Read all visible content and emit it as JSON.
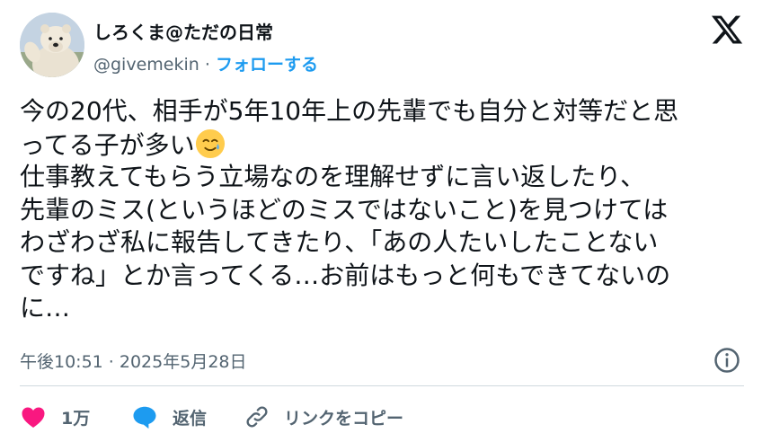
{
  "user": {
    "display_name": "しろくま@ただの日常",
    "handle": "@givemekin",
    "separator": "·",
    "follow_label": "フォローする"
  },
  "tweet": {
    "lines": [
      "今の20代、相手が5年10年上の先輩でも自分と対等だと思",
      "ってる子が多い",
      "仕事教えてもらう立場なのを理解せずに言い返したり、",
      "先輩のミス(というほどのミスではないこと)を見つけては",
      "わざわざ私に報告してきたり、「あの人たいしたことない",
      "ですね」とか言ってくる…お前はもっと何もできてないの",
      "に…"
    ]
  },
  "meta": {
    "timestamp": "午後10:51 · 2025年5月28日"
  },
  "actions": {
    "like_count": "1万",
    "reply_label": "返信",
    "copy_link_label": "リンクをコピー"
  },
  "colors": {
    "text": "#0f1419",
    "secondary": "#536471",
    "accent": "#1d9bf0",
    "like": "#f91880",
    "divider": "#cfd9de"
  },
  "icons": [
    "avatar-polar-bear",
    "x-logo-icon",
    "smiling-with-tear-emoji",
    "info-icon",
    "heart-icon",
    "reply-bubble-icon",
    "link-icon"
  ]
}
